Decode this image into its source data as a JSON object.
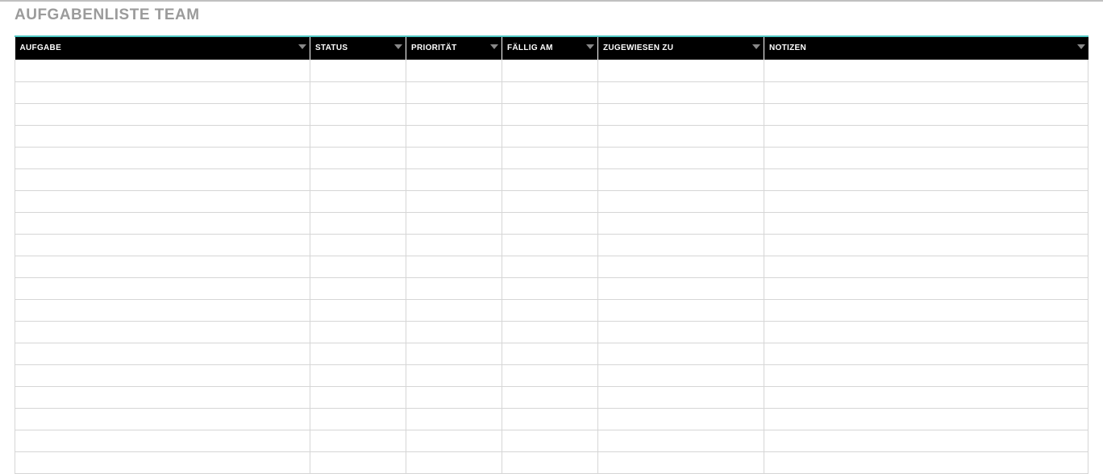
{
  "title": "AUFGABENLISTE TEAM",
  "columns": [
    {
      "label": "AUFGABE",
      "key": "aufgabe"
    },
    {
      "label": "STATUS",
      "key": "status"
    },
    {
      "label": "PRIORITÄT",
      "key": "prioritaet"
    },
    {
      "label": "FÄLLIG AM",
      "key": "faellig_am"
    },
    {
      "label": "ZUGEWIESEN ZU",
      "key": "zugewiesen_zu"
    },
    {
      "label": "NOTIZEN",
      "key": "notizen"
    }
  ],
  "rows": [
    {
      "aufgabe": "",
      "status": "",
      "prioritaet": "",
      "faellig_am": "",
      "zugewiesen_zu": "",
      "notizen": ""
    },
    {
      "aufgabe": "",
      "status": "",
      "prioritaet": "",
      "faellig_am": "",
      "zugewiesen_zu": "",
      "notizen": ""
    },
    {
      "aufgabe": "",
      "status": "",
      "prioritaet": "",
      "faellig_am": "",
      "zugewiesen_zu": "",
      "notizen": ""
    },
    {
      "aufgabe": "",
      "status": "",
      "prioritaet": "",
      "faellig_am": "",
      "zugewiesen_zu": "",
      "notizen": ""
    },
    {
      "aufgabe": "",
      "status": "",
      "prioritaet": "",
      "faellig_am": "",
      "zugewiesen_zu": "",
      "notizen": ""
    },
    {
      "aufgabe": "",
      "status": "",
      "prioritaet": "",
      "faellig_am": "",
      "zugewiesen_zu": "",
      "notizen": ""
    },
    {
      "aufgabe": "",
      "status": "",
      "prioritaet": "",
      "faellig_am": "",
      "zugewiesen_zu": "",
      "notizen": ""
    },
    {
      "aufgabe": "",
      "status": "",
      "prioritaet": "",
      "faellig_am": "",
      "zugewiesen_zu": "",
      "notizen": ""
    },
    {
      "aufgabe": "",
      "status": "",
      "prioritaet": "",
      "faellig_am": "",
      "zugewiesen_zu": "",
      "notizen": ""
    },
    {
      "aufgabe": "",
      "status": "",
      "prioritaet": "",
      "faellig_am": "",
      "zugewiesen_zu": "",
      "notizen": ""
    },
    {
      "aufgabe": "",
      "status": "",
      "prioritaet": "",
      "faellig_am": "",
      "zugewiesen_zu": "",
      "notizen": ""
    },
    {
      "aufgabe": "",
      "status": "",
      "prioritaet": "",
      "faellig_am": "",
      "zugewiesen_zu": "",
      "notizen": ""
    },
    {
      "aufgabe": "",
      "status": "",
      "prioritaet": "",
      "faellig_am": "",
      "zugewiesen_zu": "",
      "notizen": ""
    },
    {
      "aufgabe": "",
      "status": "",
      "prioritaet": "",
      "faellig_am": "",
      "zugewiesen_zu": "",
      "notizen": ""
    },
    {
      "aufgabe": "",
      "status": "",
      "prioritaet": "",
      "faellig_am": "",
      "zugewiesen_zu": "",
      "notizen": ""
    },
    {
      "aufgabe": "",
      "status": "",
      "prioritaet": "",
      "faellig_am": "",
      "zugewiesen_zu": "",
      "notizen": ""
    },
    {
      "aufgabe": "",
      "status": "",
      "prioritaet": "",
      "faellig_am": "",
      "zugewiesen_zu": "",
      "notizen": ""
    },
    {
      "aufgabe": "",
      "status": "",
      "prioritaet": "",
      "faellig_am": "",
      "zugewiesen_zu": "",
      "notizen": ""
    },
    {
      "aufgabe": "",
      "status": "",
      "prioritaet": "",
      "faellig_am": "",
      "zugewiesen_zu": "",
      "notizen": ""
    }
  ]
}
